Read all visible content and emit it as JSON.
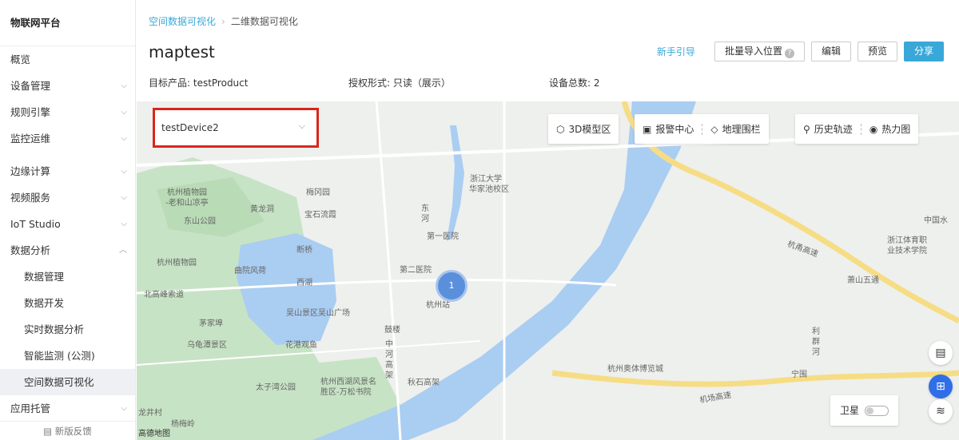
{
  "sidebar": {
    "brand": "物联网平台",
    "items": [
      {
        "label": "概览"
      },
      {
        "label": "设备管理",
        "chevron": "⌵"
      },
      {
        "label": "规则引擎",
        "chevron": "⌵"
      },
      {
        "label": "监控运维",
        "chevron": "⌵"
      },
      {
        "label": "边缘计算",
        "chevron": "⌵"
      },
      {
        "label": "视频服务",
        "chevron": "⌵"
      },
      {
        "label": "IoT Studio",
        "chevron": "⌵"
      },
      {
        "label": "数据分析",
        "chevron": "︿"
      },
      {
        "label": "数据管理"
      },
      {
        "label": "数据开发"
      },
      {
        "label": "实时数据分析"
      },
      {
        "label": "智能监测 (公测)"
      },
      {
        "label": "空间数据可视化"
      },
      {
        "label": "应用托管",
        "chevron": "⌵"
      }
    ],
    "feedback": "新版反馈",
    "feedback_icon": "feedback-icon"
  },
  "header": {
    "breadcrumb": {
      "parent": "空间数据可视化",
      "sep": "›",
      "current": "二维数据可视化"
    },
    "title": "maptest",
    "actions": {
      "guide": "新手引导",
      "import": "批量导入位置",
      "import_help": "?",
      "edit": "编辑",
      "preview": "预览",
      "share": "分享"
    },
    "meta": {
      "product": "目标产品: testProduct",
      "auth": "授权形式: 只读（展示）",
      "count": "设备总数: 2"
    }
  },
  "map": {
    "device_select": {
      "value": "testDevice2",
      "arrow": "⌵"
    },
    "tools": {
      "model3d": "3D模型区",
      "alarm": "报警中心",
      "fence": "地理围栏",
      "history": "历史轨迹",
      "heatmap": "热力图"
    },
    "tool_icons": {
      "model3d": "⬡",
      "alarm": "▣",
      "fence": "◇",
      "history": "⚲",
      "heatmap": "◉"
    },
    "cluster_count": "1",
    "satellite_label": "卫星",
    "logo": "高德地图",
    "side_icons": {
      "chat": "▤",
      "apps": "⊞",
      "layers": "≋"
    },
    "labels": [
      "浙江大学",
      "华家池校区",
      "东",
      "河",
      "第一医院",
      "第二医院",
      "杭州站",
      "鼓楼",
      "中",
      "河",
      "高",
      "架",
      "秋石高架",
      "杭州植物园",
      "-老和山凉亭",
      "东山公园",
      "黄龙洞",
      "宝石流霞",
      "梅冈园",
      "断桥",
      "杭州植物园",
      "曲院风荷",
      "西湖",
      "北高峰索道",
      "吴山景区吴山广场",
      "茅家埠",
      "乌龟潭景区",
      "花港观鱼",
      "太子湾公园",
      "杭州西湖风景名",
      "胜区-万松书院",
      "龙井村",
      "杨梅岭",
      "杭州奥体博览城",
      "杭甬高速",
      "萧山五通",
      "浙江体育职",
      "业技术学院",
      "中国水",
      "利",
      "群",
      "河",
      "宁围",
      "机场高速"
    ]
  },
  "colors": {
    "accent": "#39a8d9",
    "cluster": "#5a8fdc",
    "highlight": "#d9261c",
    "water": "#aacdf2",
    "green": "#c7e3c5",
    "road": "#f6dd85"
  }
}
